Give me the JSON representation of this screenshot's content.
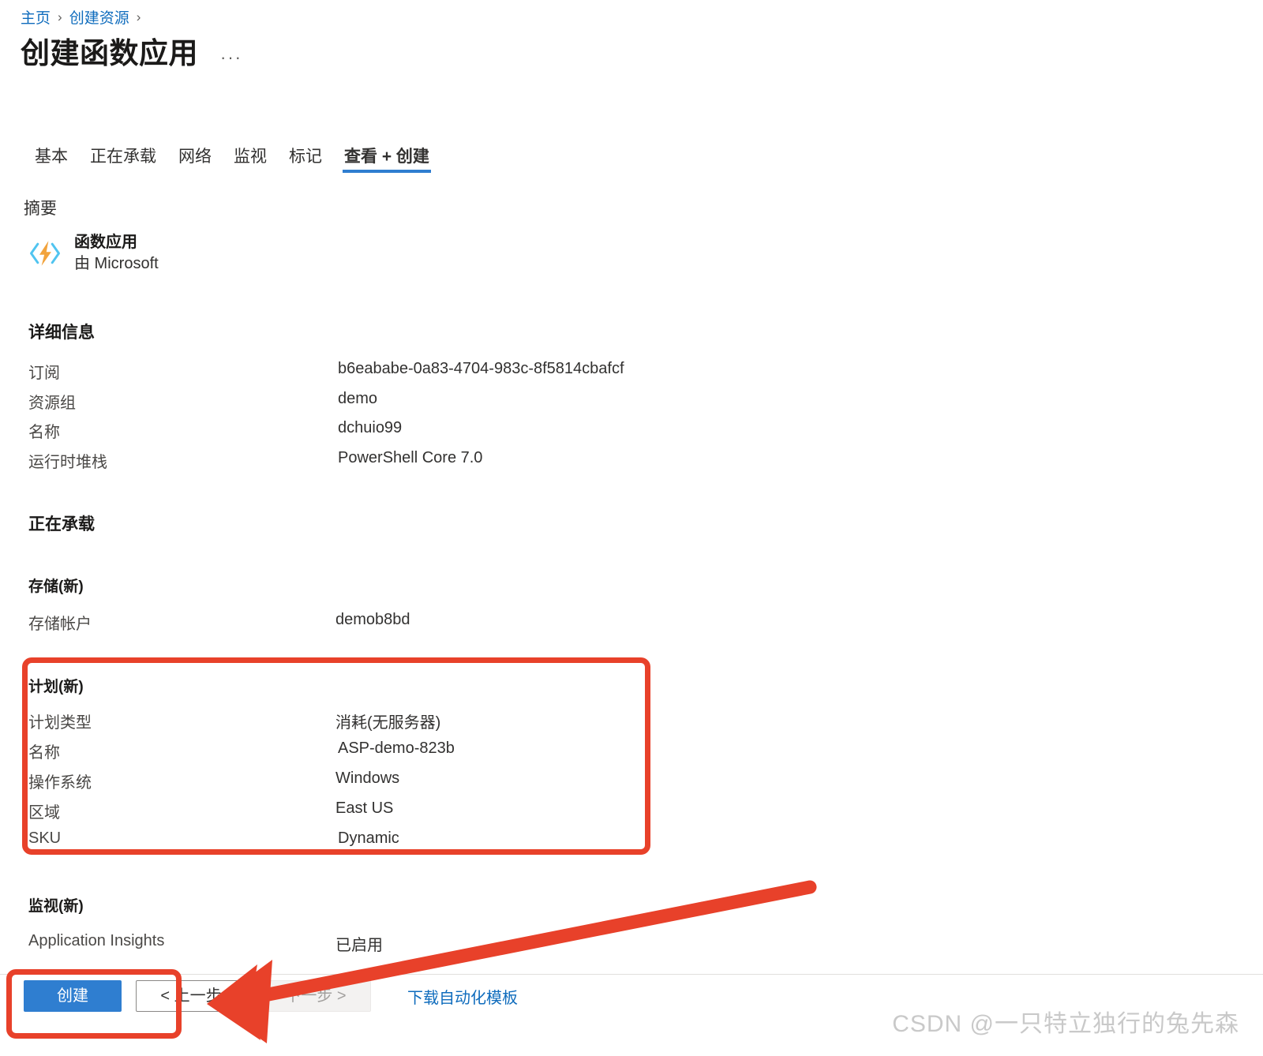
{
  "breadcrumb": {
    "items": [
      {
        "label": "主页"
      },
      {
        "label": "创建资源"
      }
    ],
    "separator": "›"
  },
  "header": {
    "title": "创建函数应用",
    "ellipsis": "···"
  },
  "tabs": [
    {
      "label": "基本",
      "active": false
    },
    {
      "label": "正在承载",
      "active": false
    },
    {
      "label": "网络",
      "active": false
    },
    {
      "label": "监视",
      "active": false
    },
    {
      "label": "标记",
      "active": false
    },
    {
      "label": "查看 + 创建",
      "active": true
    }
  ],
  "summary": {
    "heading": "摘要",
    "product": {
      "icon": "function-app-icon",
      "name": "函数应用",
      "publisher": "由 Microsoft"
    }
  },
  "details": {
    "heading": "详细信息",
    "rows": [
      {
        "label": "订阅",
        "value": "b6eababe-0a83-4704-983c-8f5814cbafcf"
      },
      {
        "label": "资源组",
        "value": "demo"
      },
      {
        "label": "名称",
        "value": "dchuio99"
      },
      {
        "label": "运行时堆栈",
        "value": "PowerShell Core 7.0"
      }
    ]
  },
  "hosting": {
    "heading": "正在承载",
    "storage": {
      "heading": "存储(新)",
      "rows": [
        {
          "label": "存储帐户",
          "value": "demob8bd"
        }
      ]
    },
    "plan": {
      "heading": "计划(新)",
      "rows": [
        {
          "label": "计划类型",
          "value": "消耗(无服务器)"
        },
        {
          "label": "名称",
          "value": "ASP-demo-823b"
        },
        {
          "label": "操作系统",
          "value": "Windows"
        },
        {
          "label": "区域",
          "value": "East US"
        },
        {
          "label": "SKU",
          "value": "Dynamic"
        }
      ]
    }
  },
  "monitoring": {
    "heading": "监视(新)",
    "rows": [
      {
        "label": "Application Insights",
        "value": "已启用"
      }
    ]
  },
  "footer": {
    "create_label": "创建",
    "previous_label": "< 上一步",
    "next_label": "下一步 >",
    "download_template_label": "下载自动化模板"
  },
  "annotations": {
    "plan_box": "highlight-plan-section",
    "create_box": "highlight-create-button",
    "arrow": "arrow-pointing-to-create-button"
  },
  "watermark": {
    "text": "CSDN @一只特立独行的兔先森"
  },
  "colors": {
    "accent_blue": "#2f7ed0",
    "link_blue": "#0f6cbd",
    "annotation_red": "#e8412a"
  }
}
